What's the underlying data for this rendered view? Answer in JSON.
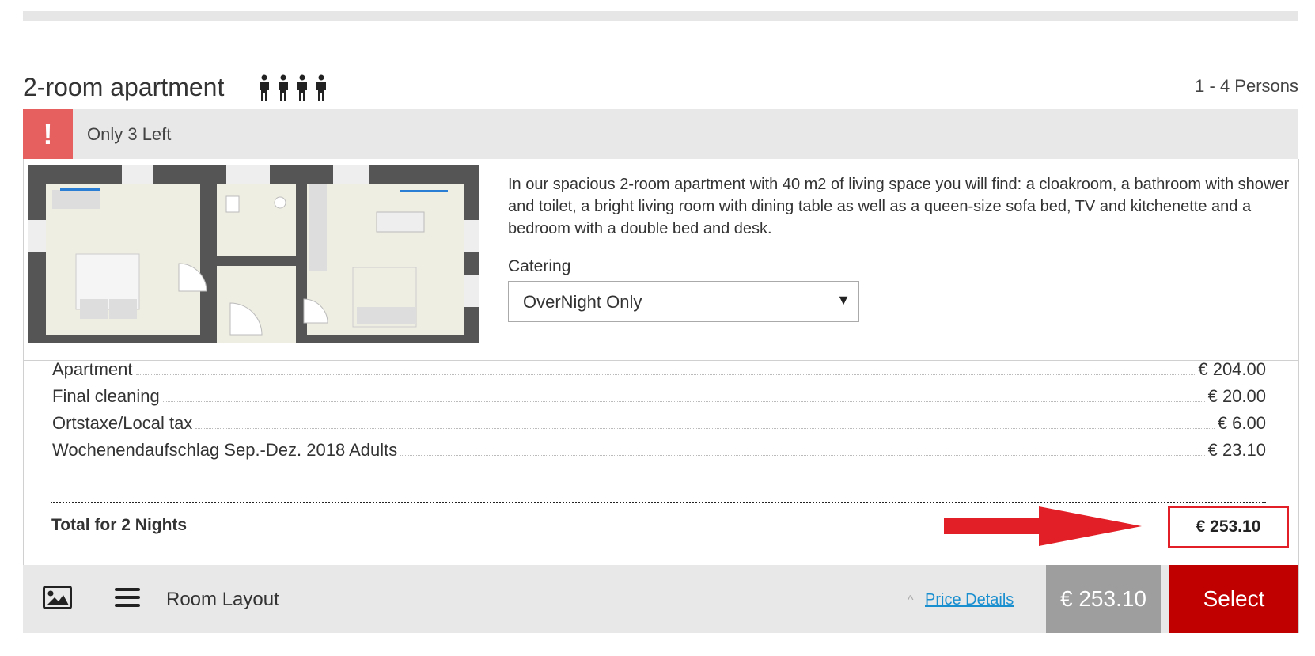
{
  "room": {
    "title": "2-room apartment",
    "persons_label": "1 - 4 Persons",
    "person_icon_count": 4
  },
  "alert": {
    "icon": "!",
    "text": "Only 3 Left"
  },
  "description": "In our spacious 2-room apartment with 40 m2 of living space you will find: a cloakroom, a bathroom with shower and toilet, a bright living room with dining table as well as a queen-size sofa bed, TV and kitchenette and a bedroom with a double bed and desk.",
  "catering": {
    "label": "Catering",
    "selected": "OverNight Only",
    "caret": "▼"
  },
  "prices": [
    {
      "label": "Apartment",
      "value": "€ 204.00"
    },
    {
      "label": "Final cleaning",
      "value": "€ 20.00"
    },
    {
      "label": "Ortstaxe/Local tax",
      "value": "€ 6.00"
    },
    {
      "label": "Wochenendaufschlag Sep.-Dez. 2018 Adults",
      "value": "€ 23.10"
    }
  ],
  "total": {
    "label": "Total for 2 Nights",
    "value": "€ 253.10"
  },
  "footer": {
    "room_layout": "Room Layout",
    "price_details": "Price Details",
    "price_details_caret": "^",
    "price": "€ 253.10",
    "select": "Select"
  },
  "colors": {
    "alert": "#e66060",
    "select": "#c00000",
    "annotation": "#e21f26",
    "link": "#1a8fd0"
  }
}
